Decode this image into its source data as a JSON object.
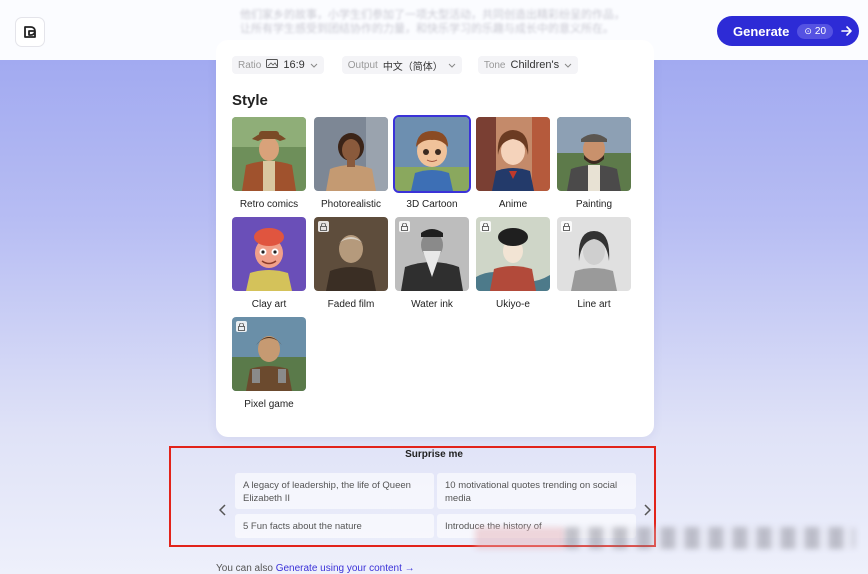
{
  "header": {
    "blurred_text": "他们家乡的故事，小学生们参加了一项大型活动，共同创造出精彩纷呈的作品，让所有学生感受到团结协作的力量，和快乐学习的乐趣与成长中的意义所在。",
    "generate_label": "Generate",
    "credits": "20"
  },
  "options": {
    "ratio_label": "Ratio",
    "ratio_value": "16:9",
    "output_label": "Output",
    "output_value": "中文（简体）",
    "tone_label": "Tone",
    "tone_value": "Children's"
  },
  "style_section": {
    "title": "Style",
    "styles": [
      {
        "name": "Retro comics",
        "selected": false,
        "locked": false
      },
      {
        "name": "Photorealistic",
        "selected": false,
        "locked": false
      },
      {
        "name": "3D Cartoon",
        "selected": true,
        "locked": false
      },
      {
        "name": "Anime",
        "selected": false,
        "locked": false
      },
      {
        "name": "Painting",
        "selected": false,
        "locked": false
      },
      {
        "name": "Clay art",
        "selected": false,
        "locked": false
      },
      {
        "name": "Faded film",
        "selected": false,
        "locked": true
      },
      {
        "name": "Water ink",
        "selected": false,
        "locked": true
      },
      {
        "name": "Ukiyo-e",
        "selected": false,
        "locked": true
      },
      {
        "name": "Line art",
        "selected": false,
        "locked": true
      },
      {
        "name": "Pixel game",
        "selected": false,
        "locked": true
      }
    ]
  },
  "surprise": {
    "title": "Surprise me",
    "suggestions": [
      "A legacy of leadership, the life of Queen Elizabeth II",
      "10 motivational quotes trending on social media",
      "5 Fun facts about the nature",
      "Introduce the history of"
    ]
  },
  "footer": {
    "prefix": "You can also",
    "link": "Generate using your content",
    "arrow": "→"
  },
  "colors": {
    "accent": "#2d2bd6",
    "highlight_border": "#e2231a"
  }
}
